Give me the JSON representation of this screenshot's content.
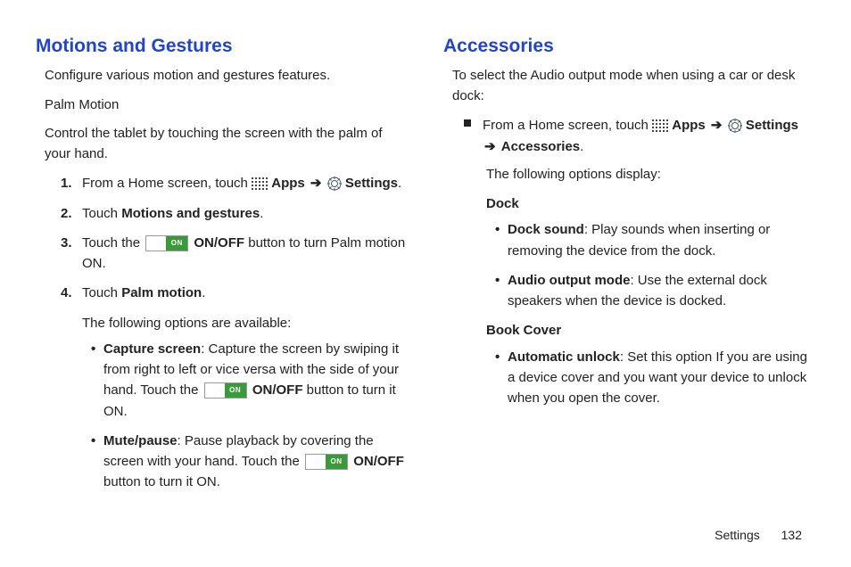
{
  "left": {
    "heading": "Motions and Gestures",
    "intro1": "Configure various motion and gestures features.",
    "intro2": "Palm Motion",
    "intro3": "Control the tablet by touching the screen with the palm of your hand.",
    "step1_a": "From a Home screen, touch ",
    "step1_apps": "Apps",
    "step1_settings": "Settings",
    "step2_a": "Touch ",
    "step2_b": "Motions and gestures",
    "step3_a": "Touch the ",
    "step3_on": "ON",
    "step3_b": "ON/OFF",
    "step3_c": " button to turn Palm motion ON.",
    "step4_a": "Touch ",
    "step4_b": "Palm motion",
    "step4_follow": "The following options are available:",
    "b1_label": "Capture screen",
    "b1_text_a": ": Capture the screen by swiping it from right to left or vice versa with the side of your hand. Touch the ",
    "b1_on": "ON",
    "b1_onoff": "ON/OFF",
    "b1_text_b": " button to turn it ON.",
    "b2_label": "Mute/pause",
    "b2_text_a": ": Pause playback by covering the screen with your hand. Touch the ",
    "b2_on": "ON",
    "b2_onoff": "ON/OFF",
    "b2_text_b": " button to turn it ON."
  },
  "right": {
    "heading": "Accessories",
    "intro": "To select the Audio output mode when using a car or desk dock:",
    "sq_a": "From a Home screen, touch ",
    "sq_apps": "Apps",
    "sq_settings": "Settings",
    "sq_acc": "Accessories",
    "follow": "The following options display:",
    "dock_heading": "Dock",
    "d1_label": "Dock sound",
    "d1_text": ": Play sounds when inserting or removing the device from the dock.",
    "d2_label": "Audio output mode",
    "d2_text": ": Use the external dock speakers when the device is docked.",
    "book_heading": "Book Cover",
    "bc1_label": "Automatic unlock",
    "bc1_text": ": Set this option If you are using a device cover and you want your device to unlock when you open the cover."
  },
  "footer": {
    "label": "Settings",
    "page": "132"
  },
  "glyphs": {
    "arrow": "➔"
  }
}
